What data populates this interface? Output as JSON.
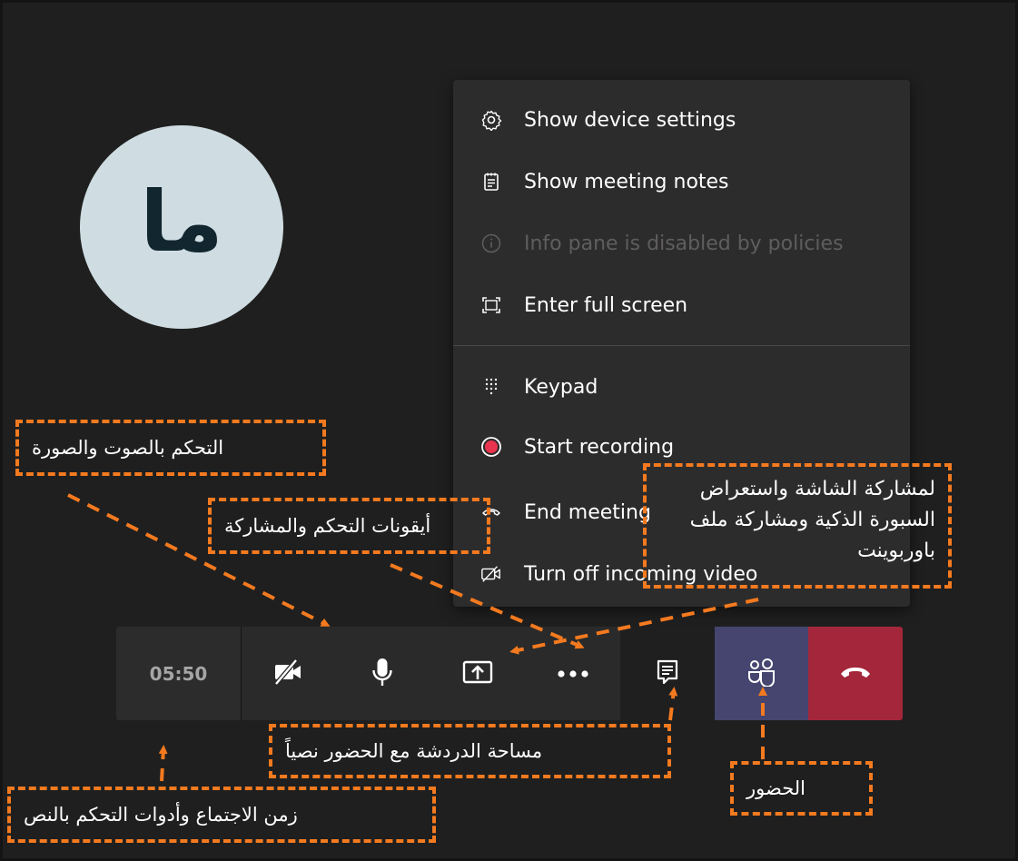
{
  "avatar": {
    "initials": "ما"
  },
  "menu": {
    "items": [
      {
        "label": "Show device settings",
        "icon": "gear-icon",
        "enabled": true
      },
      {
        "label": "Show meeting notes",
        "icon": "notes-icon",
        "enabled": true
      },
      {
        "label": "Info pane is disabled by policies",
        "icon": "info-icon",
        "enabled": false
      },
      {
        "label": "Enter full screen",
        "icon": "fullscreen-icon",
        "enabled": true
      },
      {
        "label": "Keypad",
        "icon": "keypad-icon",
        "enabled": true
      },
      {
        "label": "Start recording",
        "icon": "record-icon",
        "enabled": true
      },
      {
        "label": "End meeting",
        "icon": "end-meeting-icon",
        "enabled": true
      },
      {
        "label": "Turn off incoming video",
        "icon": "video-off-icon",
        "enabled": true
      }
    ]
  },
  "controls": {
    "timer": "05:50",
    "buttons": [
      "camera-off-icon",
      "microphone-icon",
      "share-screen-icon",
      "more-options-icon",
      "chat-icon",
      "people-icon",
      "hang-up-icon"
    ]
  },
  "annotations": {
    "av_control": "التحكم بالصوت والصورة",
    "control_icons": "أيقونات التحكم والمشاركة",
    "share_screen": "لمشاركة الشاشة واستعراض السبورة الذكية ومشاركة ملف باوربوينت",
    "chat": "مساحة الدردشة مع الحضور نصياً",
    "attendees": "الحضور",
    "timer_text": "زمن الاجتماع وأدوات التحكم بالنص"
  },
  "colors": {
    "background": "#1f1f1f",
    "annotation": "#f47a1f",
    "hangup": "#a4263a",
    "people_active": "#454570",
    "record": "#e8344e"
  }
}
